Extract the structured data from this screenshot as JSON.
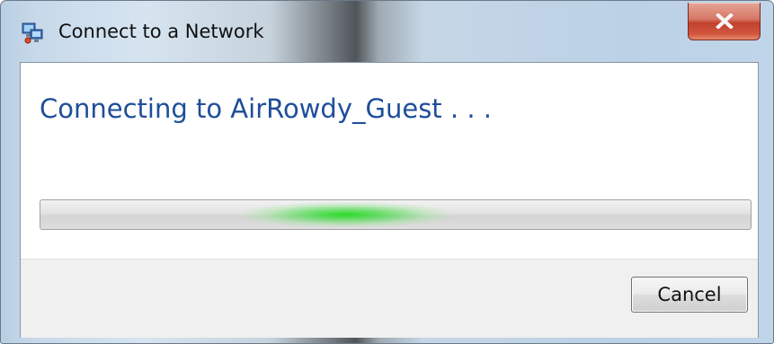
{
  "window": {
    "title": "Connect to a Network",
    "icon": "network-connect-icon",
    "close_icon": "close-icon"
  },
  "main": {
    "heading": "Connecting to AirRowdy_Guest . . .",
    "progress": {
      "mode": "indeterminate",
      "color": "#22dd22"
    }
  },
  "footer": {
    "cancel_label": "Cancel"
  },
  "colors": {
    "heading": "#1e4e9a",
    "close_button": "#c2412d"
  }
}
